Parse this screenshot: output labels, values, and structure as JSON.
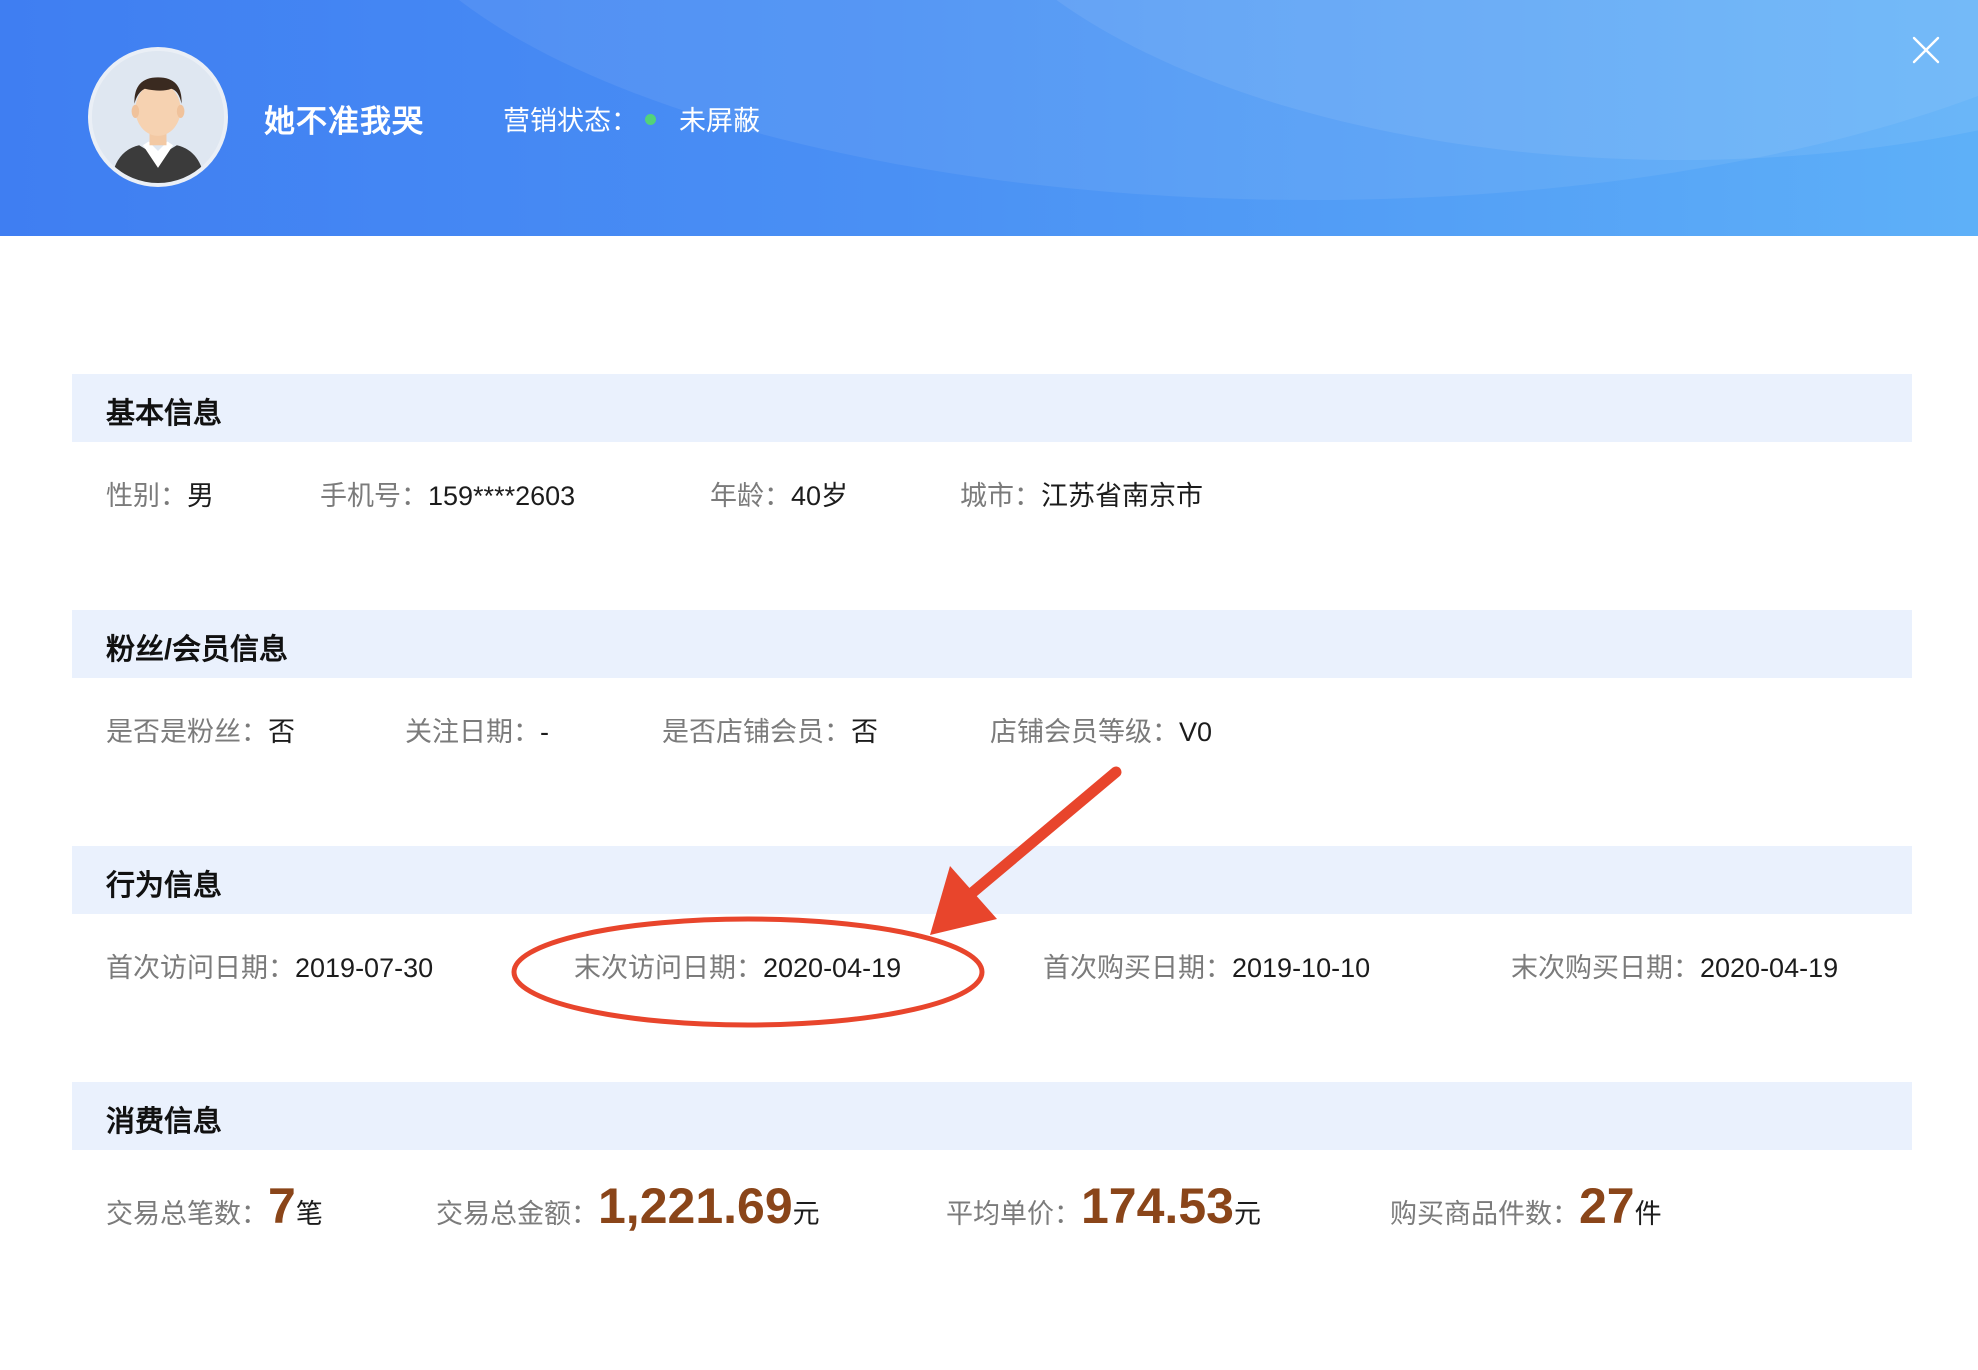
{
  "header": {
    "nickname": "她不准我哭",
    "marketing_status_label": "营销状态：",
    "marketing_status_value": "未屏蔽",
    "status_dot_color": "#52d37a",
    "close_icon": "close-icon"
  },
  "basic": {
    "title": "基本信息",
    "gender_label": "性别：",
    "gender_value": "男",
    "phone_label": "手机号：",
    "phone_value": "159****2603",
    "age_label": "年龄：",
    "age_value": "40岁",
    "city_label": "城市：",
    "city_value": "江苏省南京市"
  },
  "fans": {
    "title": "粉丝/会员信息",
    "is_fan_label": "是否是粉丝：",
    "is_fan_value": "否",
    "follow_date_label": "关注日期：",
    "follow_date_value": "-",
    "is_member_label": "是否店铺会员：",
    "is_member_value": "否",
    "member_level_label": "店铺会员等级：",
    "member_level_value": "V0"
  },
  "behavior": {
    "title": "行为信息",
    "first_visit_label": "首次访问日期：",
    "first_visit_value": "2019-07-30",
    "last_visit_label": "末次访问日期：",
    "last_visit_value": "2020-04-19",
    "first_purchase_label": "首次购买日期：",
    "first_purchase_value": "2019-10-10",
    "last_purchase_label": "末次购买日期：",
    "last_purchase_value": "2020-04-19"
  },
  "consumption": {
    "title": "消费信息",
    "tx_count_label": "交易总笔数：",
    "tx_count_value": "7",
    "tx_count_unit": "笔",
    "tx_amount_label": "交易总金额：",
    "tx_amount_value": "1,221.69",
    "tx_amount_unit": "元",
    "avg_price_label": "平均单价：",
    "avg_price_value": "174.53",
    "avg_price_unit": "元",
    "item_count_label": "购买商品件数：",
    "item_count_value": "27",
    "item_count_unit": "件",
    "value_color": "#8a4519"
  },
  "annotation": {
    "color": "#e8452c",
    "highlight_icon": "ellipse-highlight",
    "arrow_icon": "arrow-icon"
  }
}
